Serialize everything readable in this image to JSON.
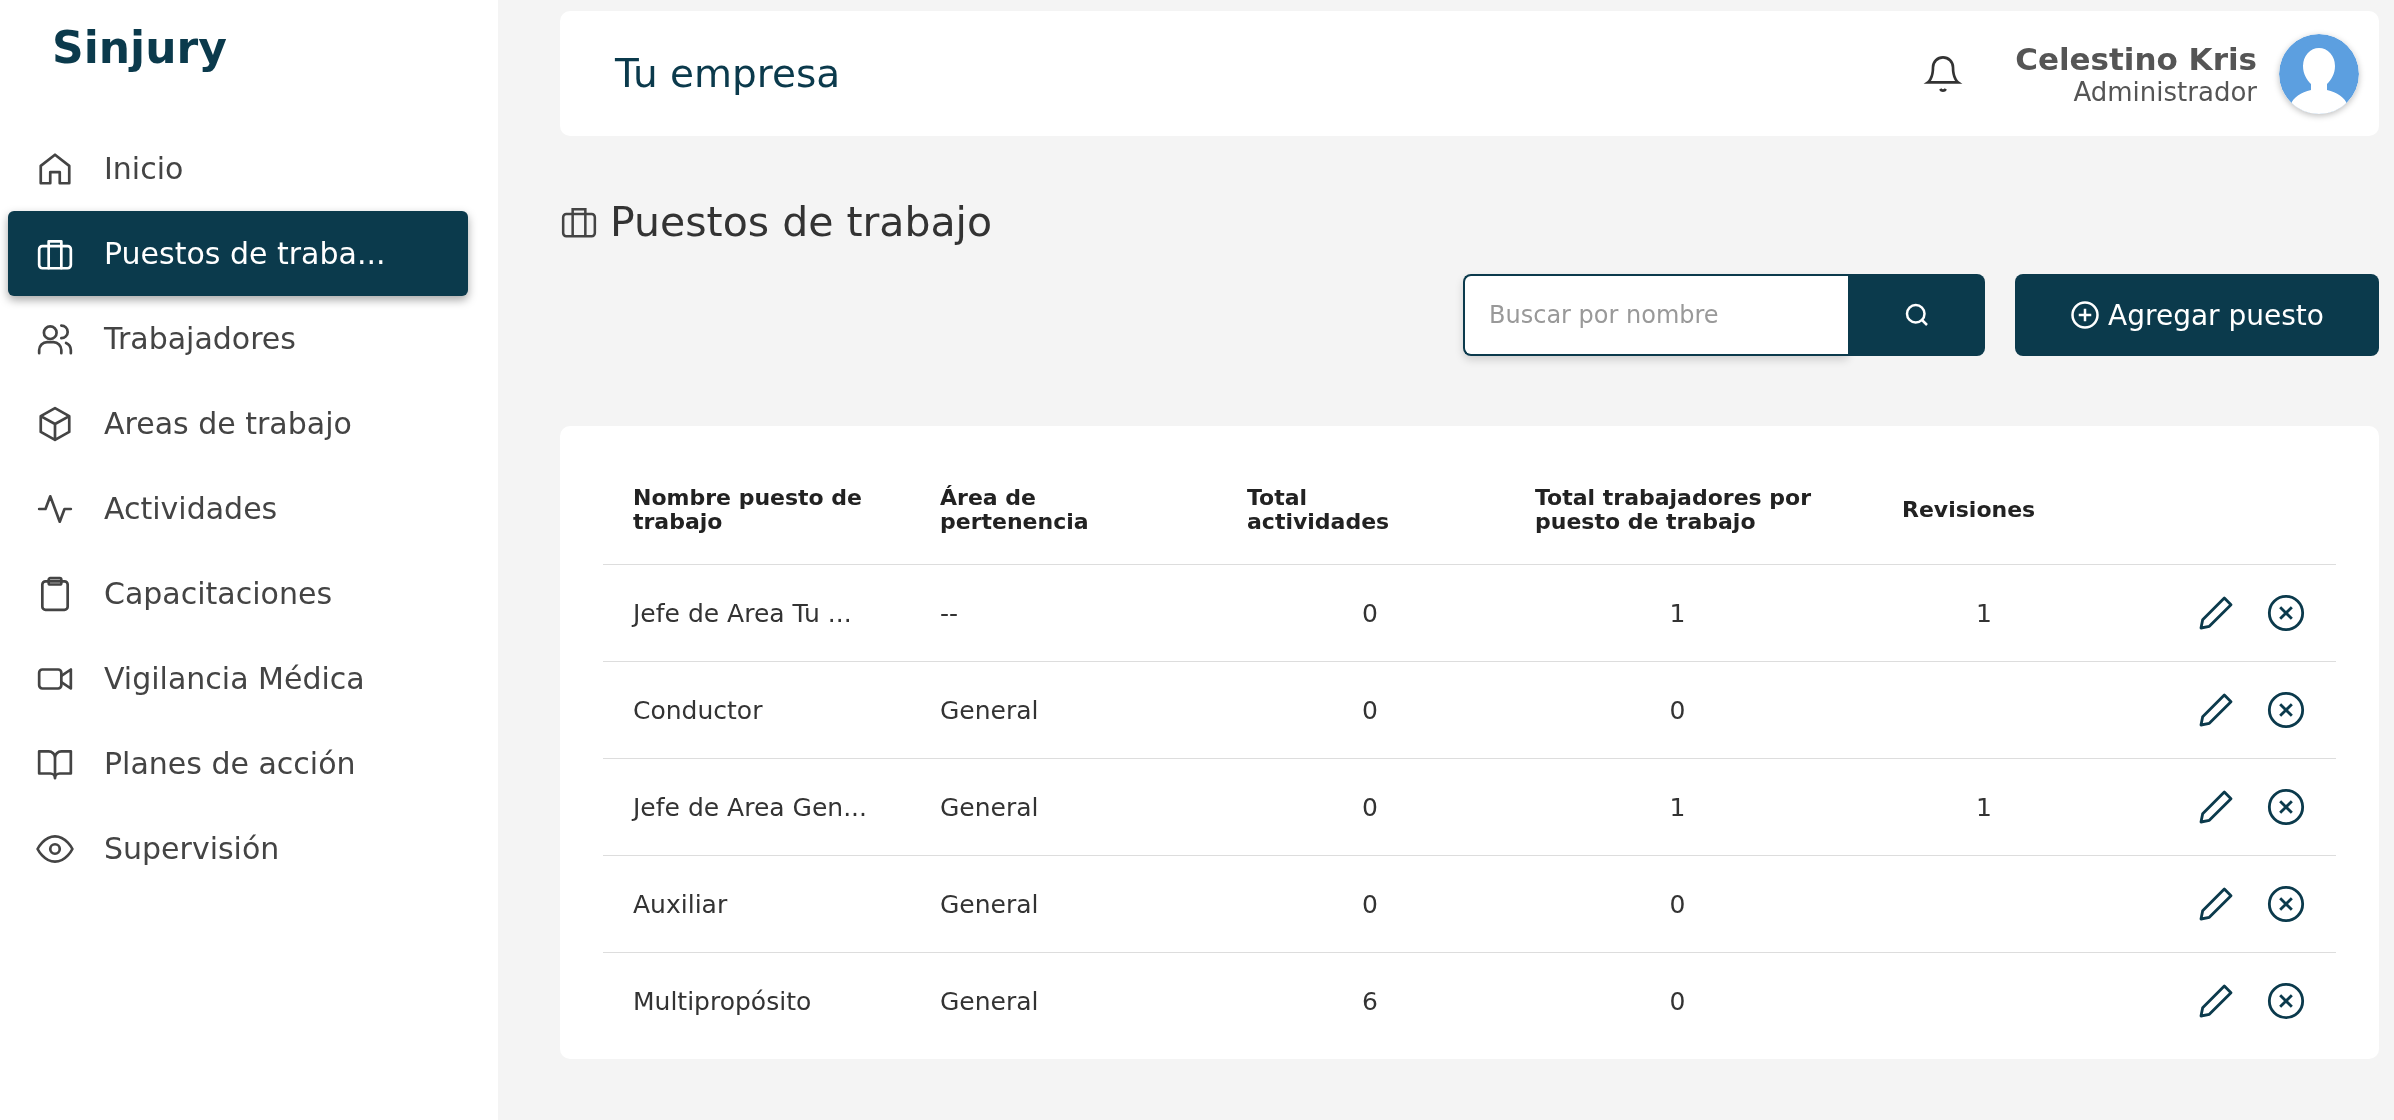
{
  "sidebar": {
    "brand": "Sinjury",
    "items": [
      {
        "label": "Inicio",
        "selected": false
      },
      {
        "label": "Puestos de traba...",
        "selected": true
      },
      {
        "label": "Trabajadores",
        "selected": false
      },
      {
        "label": "Areas de trabajo",
        "selected": false
      },
      {
        "label": "Actividades",
        "selected": false
      },
      {
        "label": "Capacitaciones",
        "selected": false
      },
      {
        "label": "Vigilancia Médica",
        "selected": false
      },
      {
        "label": "Planes de acción",
        "selected": false
      },
      {
        "label": "Supervisión",
        "selected": false
      }
    ]
  },
  "header": {
    "title": "Tu empresa",
    "user_name": "Celestino Kris",
    "user_role": "Administrador"
  },
  "page": {
    "title": "Puestos de trabajo",
    "search": {
      "placeholder": "Buscar por nombre"
    },
    "add_button": "Agregar puesto"
  },
  "table": {
    "columns": [
      "Nombre puesto de trabajo",
      "Área de pertenencia",
      "Total actividades",
      "Total trabajadores por puesto de trabajo",
      "Revisiones"
    ],
    "rows": [
      [
        "Jefe de Area Tu ...",
        "--",
        "0",
        "1",
        "1"
      ],
      [
        "Conductor",
        "General",
        "0",
        "0",
        ""
      ],
      [
        "Jefe de Area Gen...",
        "General",
        "0",
        "1",
        "1"
      ],
      [
        "Auxiliar",
        "General",
        "0",
        "0",
        ""
      ],
      [
        "Multipropósito",
        "General",
        "6",
        "0",
        ""
      ]
    ]
  }
}
